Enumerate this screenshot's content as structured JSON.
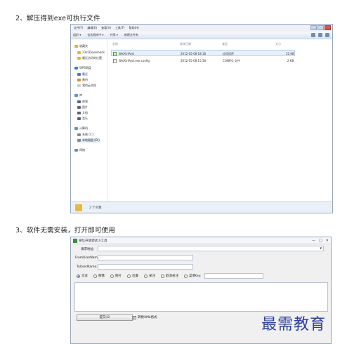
{
  "steps": {
    "s1": "2、解压得到exe可执行文件",
    "s2": "3、软件无需安装，打开即可使用"
  },
  "explorer": {
    "menu": [
      "文件(F)",
      "编辑(E)",
      "查看(V)",
      "工具(T)",
      "帮助(H)"
    ],
    "toolbar": [
      "组织 ▾",
      "包含到库中 ▾",
      "共享 ▾",
      "新建文件夹"
    ],
    "nav_items": [
      {
        "label": "收藏夹",
        "sub": false,
        "color": "#e8b03a"
      },
      {
        "label": "23k5Downloads",
        "sub": true,
        "color": "#e8b03a"
      },
      {
        "label": "最近访问的位置",
        "sub": true,
        "color": "#e8b03a"
      },
      {
        "label": "WPS网盘",
        "sub": false,
        "color": "#3b7bd8"
      },
      {
        "label": "最近",
        "sub": true,
        "color": "#3b7bd8"
      },
      {
        "label": "备份",
        "sub": true,
        "color": "#e08a2a"
      },
      {
        "label": "我的云文档",
        "sub": true,
        "color": "#cccccc"
      },
      {
        "label": "库",
        "sub": false,
        "color": "#6a8fbf"
      },
      {
        "label": "视频",
        "sub": true,
        "color": "#556677"
      },
      {
        "label": "图片",
        "sub": true,
        "color": "#556677"
      },
      {
        "label": "文档",
        "sub": true,
        "color": "#556677"
      },
      {
        "label": "音乐",
        "sub": true,
        "color": "#556677"
      },
      {
        "label": "计算机",
        "sub": false,
        "color": "#6a8fbf"
      },
      {
        "label": "系统 (C:)",
        "sub": true,
        "color": "#888888"
      },
      {
        "label": "本地磁盘 (D:)",
        "sub": true,
        "color": "#888888"
      },
      {
        "label": "网络",
        "sub": false,
        "color": "#6a8fbf"
      }
    ],
    "columns": [
      "名称",
      "修改日期",
      "类型",
      "大小"
    ],
    "files": [
      {
        "name": "WeiXinPost",
        "date": "2012-05-08 18:18",
        "type": "应用程序",
        "size": "52 KB",
        "kind": "app"
      },
      {
        "name": "WeiXinPost.exe.config",
        "date": "2012-05-08 15:58",
        "type": "CONFIG 文件",
        "size": "2 KB",
        "kind": "doc"
      }
    ],
    "status": "2 个对象"
  },
  "tool": {
    "title": "微信开放调试小工具",
    "window_controls": [
      "—",
      "□",
      "✕"
    ],
    "request_label": "请求地址:",
    "from_label": "FromUserName:",
    "to_label": "ToUserName:",
    "radios": [
      "文本",
      "图像",
      "图片",
      "位置",
      "关注",
      "取消关注",
      "菜单"
    ],
    "key_label": "Key:",
    "submit": "提交(S)",
    "checkbox_label": "转换XML格式"
  },
  "watermark": "最需教育"
}
